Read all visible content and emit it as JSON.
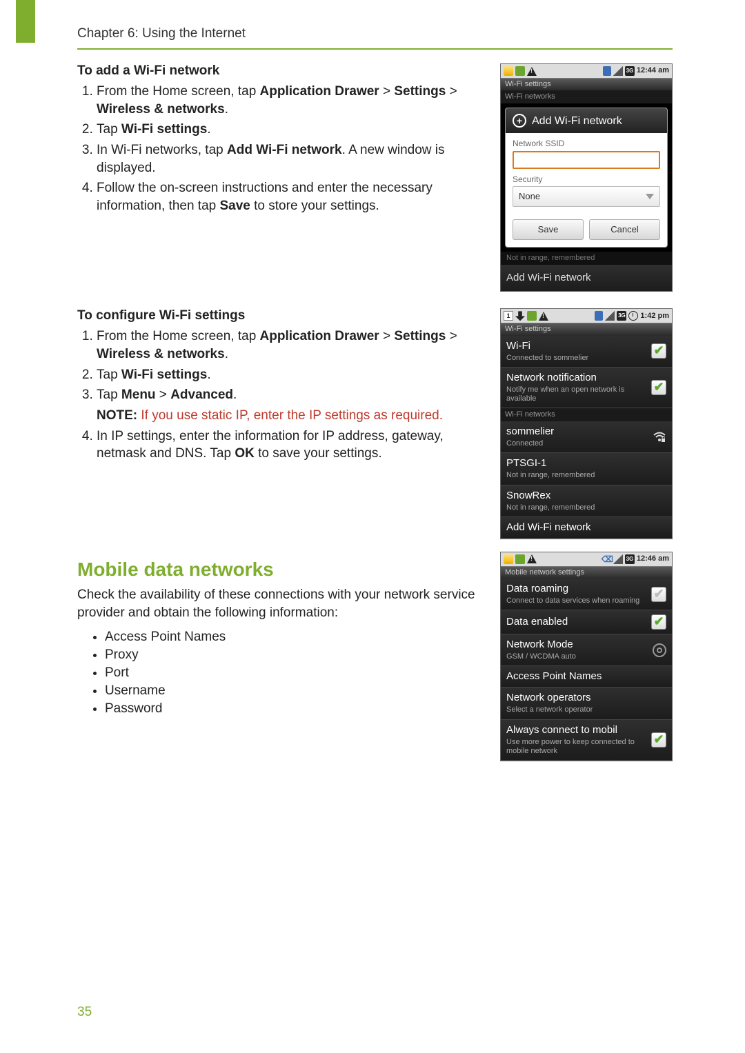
{
  "header": {
    "chapter": "Chapter 6: Using the Internet"
  },
  "page_number": "35",
  "sec1": {
    "subhead": "To add a Wi-Fi network",
    "step1_pre": "From the Home screen, tap ",
    "step1_bold1": "Application Drawer",
    "step1_mid": " > ",
    "step1_bold2": "Settings",
    "step1_mid2": " > ",
    "step1_bold3": "Wireless & networks",
    "step1_end": ".",
    "step2_pre": "Tap ",
    "step2_bold": "Wi-Fi settings",
    "step2_end": ".",
    "step3_pre": "In Wi-Fi networks, tap ",
    "step3_bold": "Add Wi-Fi network",
    "step3_end": ". A new window is displayed.",
    "step4_pre": "Follow the on-screen instructions and enter the necessary information, then tap ",
    "step4_bold": "Save",
    "step4_end": " to store your settings."
  },
  "sec2": {
    "subhead": "To configure Wi-Fi settings",
    "step1_pre": "From the Home screen, tap ",
    "step1_bold1": "Application Drawer",
    "step1_mid": " > ",
    "step1_bold2": "Settings",
    "step1_mid2": " > ",
    "step1_bold3": "Wireless & networks",
    "step1_end": ".",
    "step2_pre": "Tap ",
    "step2_bold": "Wi-Fi settings",
    "step2_end": ".",
    "step3_pre": "Tap ",
    "step3_bold1": "Menu",
    "step3_mid": " > ",
    "step3_bold2": "Advanced",
    "step3_end": ".",
    "note_leadin": "NOTE:",
    "note_body": " If you use static IP, enter the IP settings as required.",
    "step4_pre": "In IP settings, enter the information for IP address, gateway, netmask and DNS. Tap ",
    "step4_bold": "OK",
    "step4_end": " to save your settings."
  },
  "sec3": {
    "heading": "Mobile data networks",
    "intro": "Check the availability of these connections with your network service provider and obtain the following information:",
    "bullets": [
      "Access Point Names",
      "Proxy",
      "Port",
      "Username",
      "Password"
    ]
  },
  "shot1": {
    "status_time": "12:44 am",
    "titlebar": "Wi-Fi settings",
    "section": "Wi-Fi networks",
    "dialog_title": "Add Wi-Fi network",
    "ssid_label": "Network SSID",
    "security_label": "Security",
    "security_value": "None",
    "btn_save": "Save",
    "btn_cancel": "Cancel",
    "dim_line": "Not in range, remembered",
    "bottom_row": "Add Wi-Fi network"
  },
  "shot2": {
    "status_time": "1:42 pm",
    "titlebar": "Wi-Fi settings",
    "row_wifi_title": "Wi-Fi",
    "row_wifi_sub": "Connected to sommelier",
    "row_notif_title": "Network notification",
    "row_notif_sub": "Notify me when an open network is available",
    "section": "Wi-Fi networks",
    "net1_title": "sommelier",
    "net1_sub": "Connected",
    "net2_title": "PTSGI-1",
    "net2_sub": "Not in range, remembered",
    "net3_title": "SnowRex",
    "net3_sub": "Not in range, remembered",
    "addnet": "Add Wi-Fi network"
  },
  "shot3": {
    "status_time": "12:46 am",
    "titlebar": "Mobile network settings",
    "r1_title": "Data roaming",
    "r1_sub": "Connect to data services when roaming",
    "r2_title": "Data enabled",
    "r3_title": "Network Mode",
    "r3_sub": "GSM / WCDMA auto",
    "r4_title": "Access Point Names",
    "r5_title": "Network operators",
    "r5_sub": "Select a network operator",
    "r6_title": "Always connect to mobil",
    "r6_sub": "Use more power to keep connected to mobile network"
  }
}
